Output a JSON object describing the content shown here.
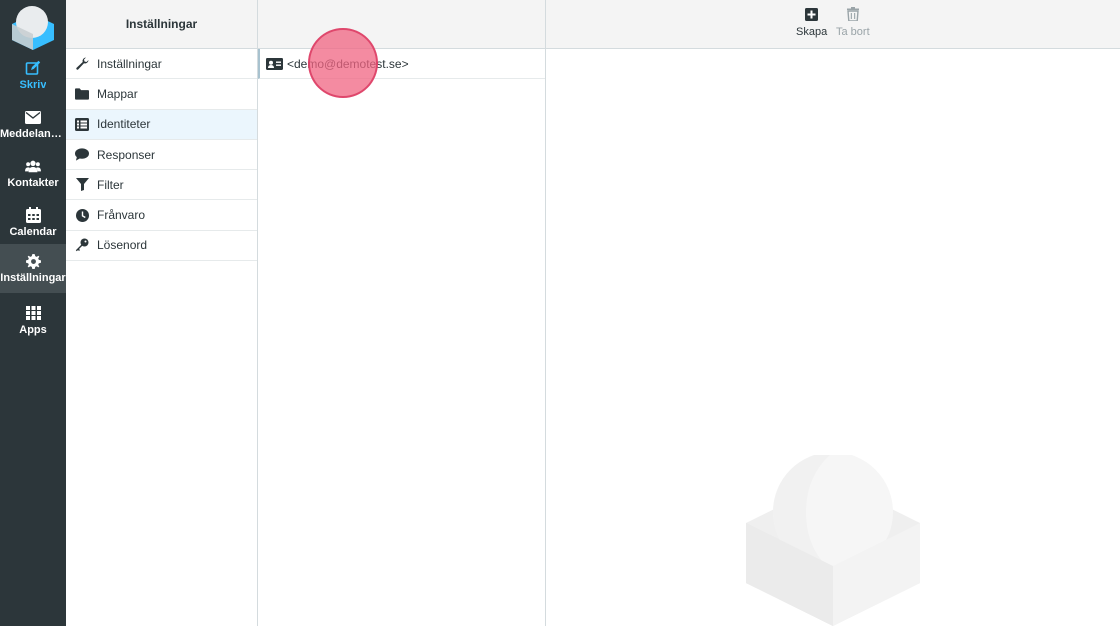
{
  "nav": {
    "items": [
      {
        "label": "Skriv",
        "icon": "compose-icon"
      },
      {
        "label": "Meddeland…",
        "icon": "envelope-icon"
      },
      {
        "label": "Kontakter",
        "icon": "users-icon"
      },
      {
        "label": "Calendar",
        "icon": "calendar-icon"
      },
      {
        "label": "Inställningar",
        "icon": "gear-icon"
      },
      {
        "label": "Apps",
        "icon": "grid-icon"
      }
    ]
  },
  "settings": {
    "title": "Inställningar",
    "items": [
      {
        "label": "Inställningar",
        "icon": "wrench-icon"
      },
      {
        "label": "Mappar",
        "icon": "folder-icon"
      },
      {
        "label": "Identiteter",
        "icon": "id-list-icon"
      },
      {
        "label": "Responser",
        "icon": "speech-bubble-icon"
      },
      {
        "label": "Filter",
        "icon": "filter-icon"
      },
      {
        "label": "Frånvaro",
        "icon": "clock-icon"
      },
      {
        "label": "Lösenord",
        "icon": "key-icon"
      }
    ],
    "selected": "Identiteter"
  },
  "identities": {
    "items": [
      {
        "label": "<demo@demotest.se>",
        "icon": "id-card-icon"
      }
    ]
  },
  "toolbar": {
    "create_label": "Skapa",
    "delete_label": "Ta bort"
  },
  "colors": {
    "nav_bg": "#2c363a",
    "accent": "#37beff",
    "selected_bg": "#ebf6fd",
    "click_marker": "#f06482"
  }
}
